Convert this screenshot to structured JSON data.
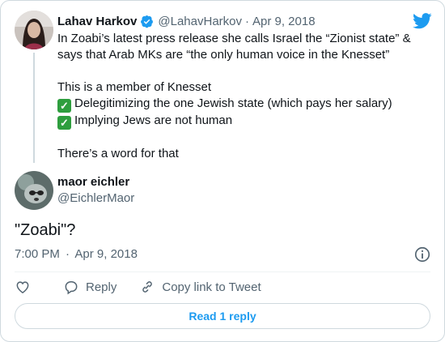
{
  "parent_tweet": {
    "author_name": "Lahav Harkov",
    "handle": "@LahavHarkov",
    "separator": "·",
    "date": "Apr 9, 2018",
    "verified_icon": "verified-badge-icon",
    "lines": [
      "In Zoabi’s latest press release she calls Israel the “Zionist state” & says that Arab MKs are “the only human voice in the Knesset”",
      "This is a member of Knesset",
      "Delegitimizing the one Jewish state (which pays her salary)",
      "Implying Jews are not human",
      "There’s a word for that"
    ],
    "checkmark": "✓"
  },
  "reply_tweet": {
    "author_name": "maor eichler",
    "handle": "@EichlerMaor",
    "text": "\"Zoabi\"?",
    "time": "7:00 PM",
    "separator": "·",
    "date": "Apr 9, 2018"
  },
  "actions": {
    "like_icon": "heart-icon",
    "reply_label": "Reply",
    "copy_link_label": "Copy link to Tweet"
  },
  "read_replies_label": "Read 1 reply",
  "colors": {
    "brand": "#1d9bf0",
    "muted_text": "#536471",
    "check_green": "#2e9e3e"
  }
}
